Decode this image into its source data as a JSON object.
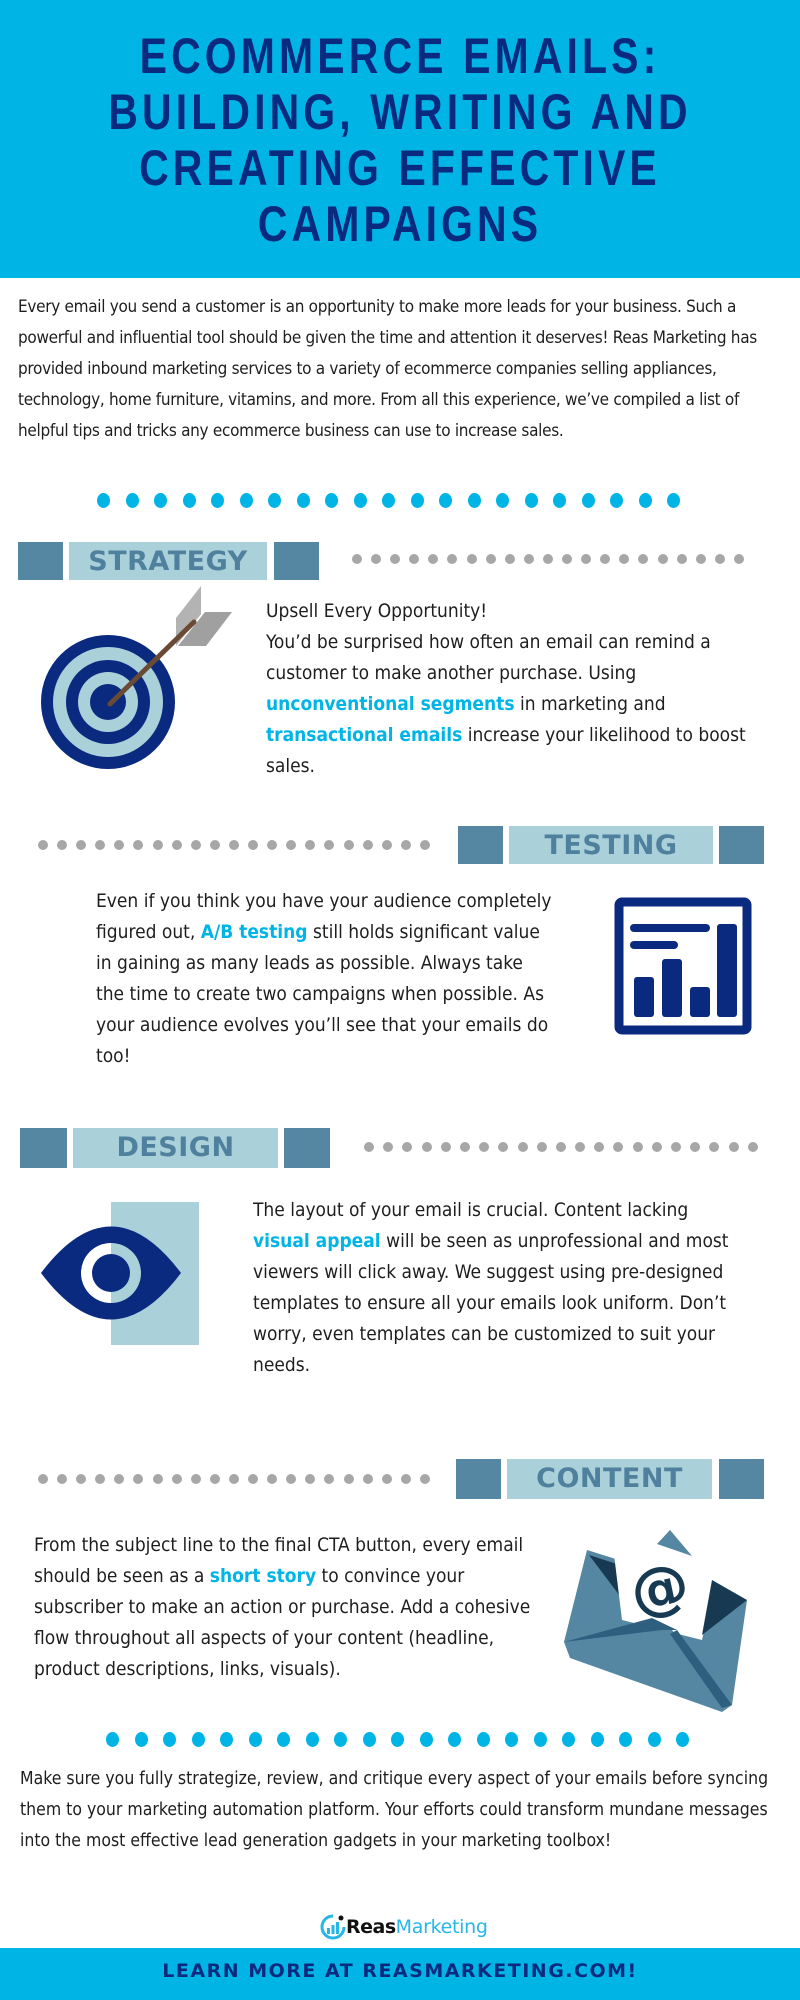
{
  "header": {
    "title_lines": [
      "ECOMMERCE EMAILS:",
      "BUILDING, WRITING AND",
      "CREATING EFFECTIVE",
      "CAMPAIGNS"
    ]
  },
  "intro": {
    "text": "Every email you send a customer is an opportunity to make more leads for your business. Such a powerful and influential tool should be given the time and attention it deserves! Reas Marketing has provided inbound marketing services to a variety of ecommerce companies selling appliances, technology, home furniture, vitamins, and more. From all this experience, we’ve compiled a list of helpful tips and tricks any ecommerce business can use to increase sales."
  },
  "sections": [
    {
      "label": "STRATEGY",
      "icon": "target-arrow-icon",
      "heading": "Upsell Every Opportunity!",
      "parts": [
        {
          "t": "You’d be surprised how often an email can remind a customer to make another purchase. Using "
        },
        {
          "t": "unconventional segments",
          "hl": true
        },
        {
          "t": " in marketing and "
        },
        {
          "t": "transactional emails",
          "hl": true
        },
        {
          "t": " increase your likelihood to boost sales."
        }
      ]
    },
    {
      "label": "TESTING",
      "icon": "bar-chart-icon",
      "parts": [
        {
          "t": "Even if you think you have your audience completely figured out, "
        },
        {
          "t": "A/B testing",
          "hl": true
        },
        {
          "t": " still holds significant value in gaining as many leads as possible. Always take the time to create two campaigns when possible. As your audience evolves you’ll see that your emails do too!"
        }
      ]
    },
    {
      "label": "DESIGN",
      "icon": "eye-icon",
      "parts": [
        {
          "t": "The layout of your email is crucial. Content lacking "
        },
        {
          "t": "visual appeal",
          "hl": true
        },
        {
          "t": " will be seen as unprofessional and most viewers will click away. We suggest using pre-designed templates to ensure all your emails look uniform. Don’t worry, even templates can be customized to suit your needs."
        }
      ]
    },
    {
      "label": "CONTENT",
      "icon": "email-envelope-icon",
      "parts": [
        {
          "t": "From the subject line to the final CTA button, every email should be seen as a "
        },
        {
          "t": "short story",
          "hl": true
        },
        {
          "t": " to convince your subscriber to make an action or purchase. Add a cohesive flow throughout all aspects of your content (headline, product descriptions, links, visuals)."
        }
      ]
    }
  ],
  "closing": {
    "text": "Make sure you fully strategize, review, and critique every aspect of your emails before syncing them to your marketing automation platform. Your efforts could transform mundane messages into the most effective lead generation gadgets in your marketing toolbox!"
  },
  "logo": {
    "reas": "Reas",
    "marketing": "Marketing"
  },
  "footer": {
    "cta": "LEARN MORE AT REASMARKETING.COM!"
  },
  "colors": {
    "accent_cyan": "#00b5e5",
    "navy": "#0a2a7f",
    "steel_blue": "#5587a3",
    "light_blue": "#aad0da",
    "dot_gray": "#a7a7a7"
  }
}
